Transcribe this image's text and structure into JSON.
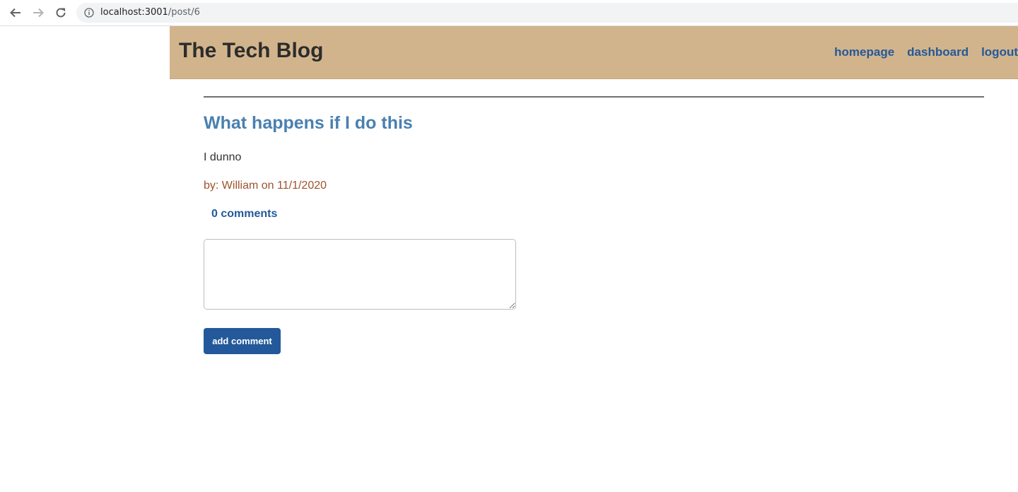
{
  "browser": {
    "url_host": "localhost:3001",
    "url_path": "/post/6"
  },
  "header": {
    "title": "The Tech Blog",
    "nav": {
      "homepage": "homepage",
      "dashboard": "dashboard",
      "logout": "logout"
    }
  },
  "post": {
    "title": "What happens if I do this",
    "body": "I dunno",
    "byline": "by: William on 11/1/2020",
    "comments_count": "0 comments"
  },
  "comment_form": {
    "value": "",
    "button_label": "add comment"
  },
  "colors": {
    "header_bg": "#d2b48c",
    "accent": "#23599a",
    "post_title": "#4a80b0",
    "byline": "#a0522d"
  },
  "icons": [
    "back-arrow-icon",
    "forward-arrow-icon",
    "reload-icon",
    "info-icon"
  ]
}
